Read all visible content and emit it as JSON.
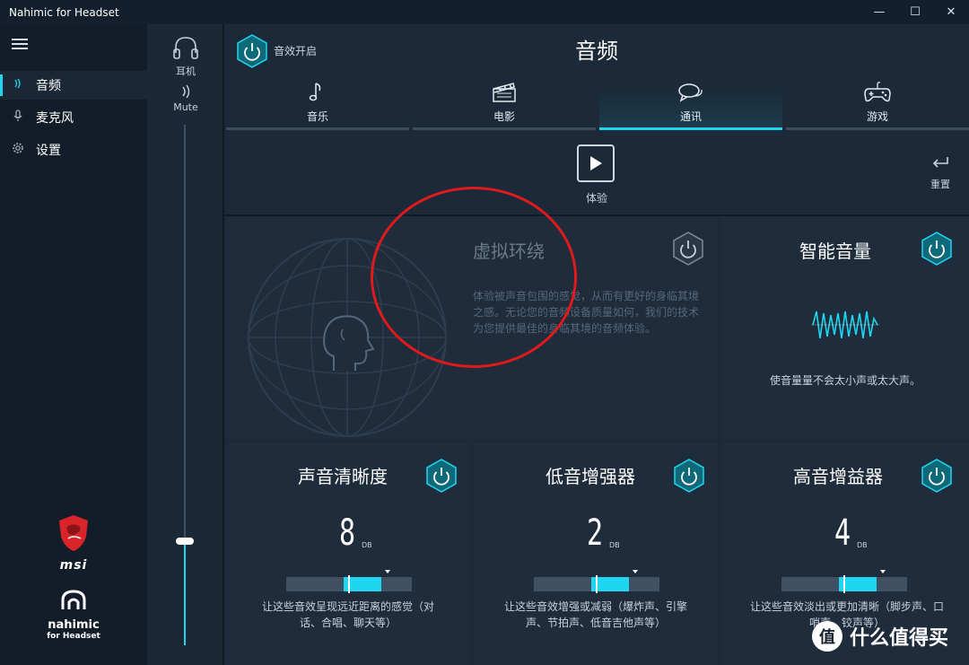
{
  "window": {
    "title": "Nahimic for Headset",
    "controls": [
      "—",
      "☐",
      "✕"
    ]
  },
  "sidebar": {
    "items": [
      {
        "label": "音频",
        "icon": "audio-wave-icon",
        "active": true
      },
      {
        "label": "麦克风",
        "icon": "microphone-icon",
        "active": false
      },
      {
        "label": "设置",
        "icon": "gear-icon",
        "active": false
      }
    ],
    "logos": {
      "msi": "msi",
      "nahimic": "nahimic",
      "nahimic_sub": "for Headset"
    }
  },
  "volume": {
    "device_label": "耳机",
    "mute_label": "Mute",
    "level": 0.2
  },
  "header": {
    "power_label": "音效开启",
    "title": "音频"
  },
  "tabs": [
    {
      "label": "音乐",
      "icon": "music-note-icon",
      "active": false
    },
    {
      "label": "电影",
      "icon": "clapperboard-icon",
      "active": false
    },
    {
      "label": "通讯",
      "icon": "chat-bubble-icon",
      "active": true
    },
    {
      "label": "游戏",
      "icon": "gamepad-icon",
      "active": false
    }
  ],
  "experience": {
    "label": "体验"
  },
  "reset": {
    "label": "重置"
  },
  "cards": {
    "surround": {
      "title": "虚拟环绕",
      "desc": "体验被声音包围的感觉，从而有更好的身临其境之感。无论您的音频设备质量如何，我们的技术为您提供最佳的身临其境的音频体验。",
      "enabled": false
    },
    "smart_volume": {
      "title": "智能音量",
      "desc": "使音量量不会太小声或太大声。",
      "enabled": true
    },
    "clarity": {
      "title": "声音清晰度",
      "value": "8",
      "unit": "DB",
      "level": 0.5,
      "desc": "让这些音效呈现远近距离的感觉（对话、合唱、聊天等）"
    },
    "bass": {
      "title": "低音增强器",
      "value": "2",
      "unit": "DB",
      "level": 0.5,
      "desc": "让这些音效增强或减弱（爆炸声、引擎声、节拍声、低音吉他声等）"
    },
    "treble": {
      "title": "高音增益器",
      "value": "4",
      "unit": "DB",
      "level": 0.5,
      "desc": "让这些音效淡出或更加清晰（脚步声、口哨声、铰声等）"
    }
  },
  "watermark": {
    "text": "什么值得买",
    "icon": "值"
  },
  "colors": {
    "accent": "#1fd6f0",
    "background": "#1b2938",
    "annotation": "#e01a1a"
  }
}
